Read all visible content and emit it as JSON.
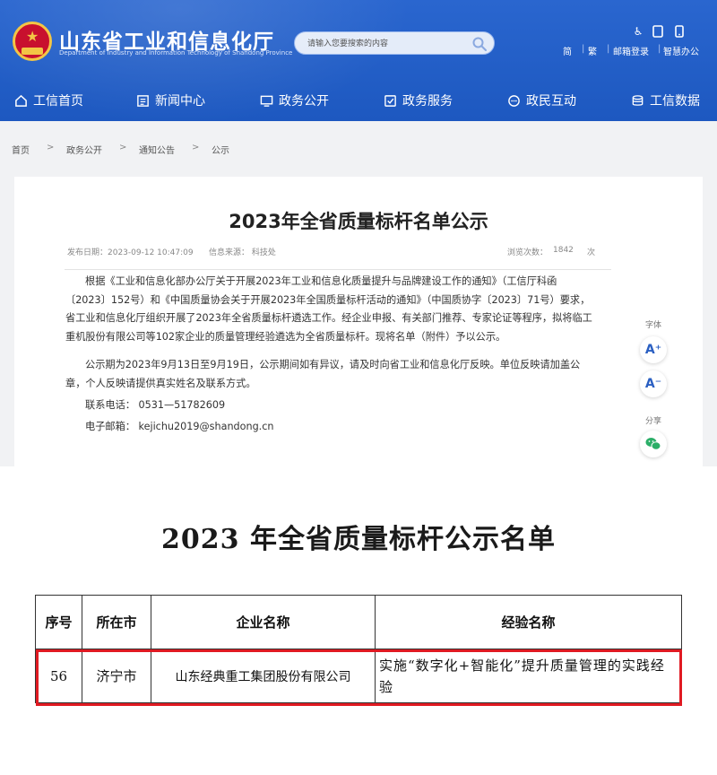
{
  "header": {
    "title": "山东省工业和信息化厅",
    "subtitle": "Department of Industry and Information Technology of Shandong Province",
    "search_placeholder": "请输入您要搜索的内容",
    "links": [
      "简",
      "繁",
      "邮箱登录",
      "智慧办公"
    ],
    "tool_icons": [
      "accessibility-icon",
      "tablet-icon",
      "phone-icon"
    ]
  },
  "nav": [
    {
      "label": "工信首页",
      "icon": "home-icon"
    },
    {
      "label": "新闻中心",
      "icon": "news-icon"
    },
    {
      "label": "政务公开",
      "icon": "monitor-icon"
    },
    {
      "label": "政务服务",
      "icon": "service-icon"
    },
    {
      "label": "政民互动",
      "icon": "chat-icon"
    },
    {
      "label": "工信数据",
      "icon": "database-icon"
    }
  ],
  "breadcrumb": [
    "首页",
    "政务公开",
    "通知公告",
    "公示"
  ],
  "article": {
    "title": "2023年全省质量标杆名单公示",
    "published": "发布日期：2023-09-12 10:47:09",
    "source": "信息来源：  科技处",
    "views_label": "浏览次数：",
    "views": "1842",
    "views_unit": "次",
    "para1": [
      "根据《工业和信息化部办公厅关于开展2023年工业和信息化质量提升与品牌建设工作的通知》（工信厅科函",
      "〔2023〕152号）和《中国质量协会关于开展2023年全国质量标杆活动的通知》（中国质协字〔2023〕71号）要求，",
      "省工业和信息化厅组织开展了2023年全省质量标杆遴选工作。经企业申报、有关部门推荐、专家论证等程序，拟将临工",
      "重机股份有限公司等102家企业的质量管理经验遴选为全省质量标杆。现将名单（附件）予以公示。"
    ],
    "para2": [
      "公示期为2023年9月13日至9月19日，公示期间如有异议，请及时向省工业和信息化厅反映。单位反映请加盖公",
      "章，个人反映请提供真实姓名及联系方式。"
    ],
    "phone": "联系电话：  0531—51782609",
    "email": "电子邮箱：  kejichu2019@shandong.cn"
  },
  "side_tools": {
    "font_label": "字体",
    "font_up": "A⁺",
    "font_down": "A⁻",
    "share_label": "分享"
  },
  "document": {
    "title": "2023 年全省质量标杆公示名单",
    "headers": [
      "序号",
      "所在市",
      "企业名称",
      "经验名称"
    ],
    "row": [
      "56",
      "济宁市",
      "山东经典重工集团股份有限公司",
      "实施“数字化+智能化”提升质量管理的实践经验"
    ]
  },
  "colors": {
    "header_blue": "#1f5fc9",
    "highlight_red": "#e01a22",
    "wechat_green": "#2aae67"
  }
}
